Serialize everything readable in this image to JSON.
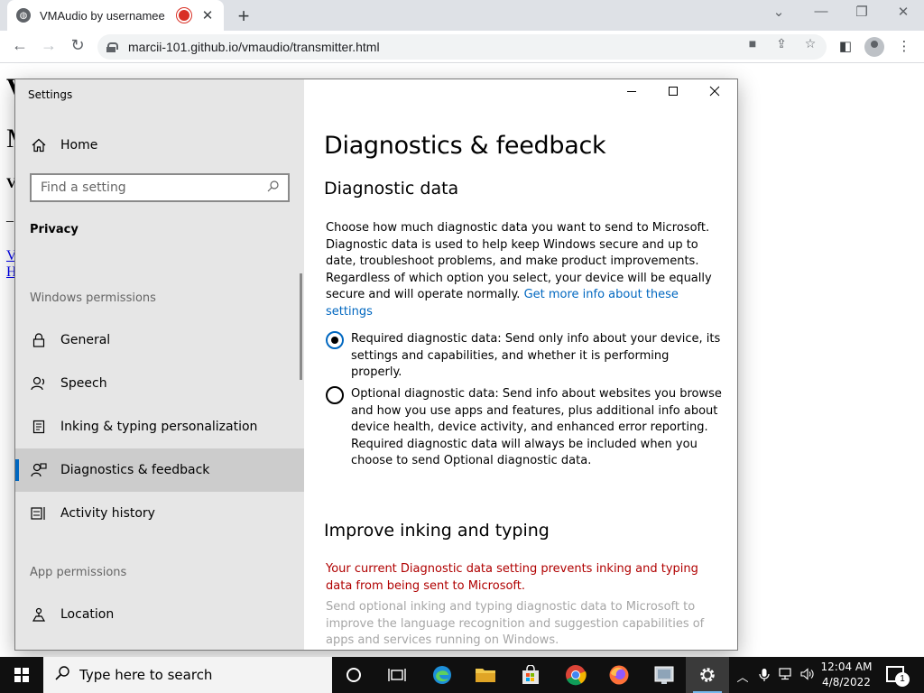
{
  "browser": {
    "tab_title": "VMAudio by usernamee",
    "tab_close": "✕",
    "new_tab": "+",
    "url": "marcii-101.github.io/vmaudio/transmitter.html",
    "win_minimize": "—",
    "win_restore": "❐",
    "win_close": "✕",
    "win_tabsearch": "⌄"
  },
  "bg_page": {
    "frag_1": "V",
    "frag_2": "M",
    "frag_3": "V",
    "frag_4": "_",
    "link_1": "V",
    "link_2": "H"
  },
  "settings": {
    "window_title": "Settings",
    "home_label": "Home",
    "search_placeholder": "Find a setting",
    "category": "Privacy",
    "windows_permissions_heading": "Windows permissions",
    "app_permissions_heading": "App permissions",
    "nav_items": [
      {
        "label": "General",
        "icon": "lock-icon"
      },
      {
        "label": "Speech",
        "icon": "speech-icon"
      },
      {
        "label": "Inking & typing personalization",
        "icon": "inking-icon"
      },
      {
        "label": "Diagnostics & feedback",
        "icon": "diagnostics-icon",
        "selected": true
      },
      {
        "label": "Activity history",
        "icon": "activity-icon"
      }
    ],
    "location_label": "Location",
    "page_title": "Diagnostics & feedback",
    "diag_heading": "Diagnostic data",
    "diag_description": "Choose how much diagnostic data you want to send to Microsoft. Diagnostic data is used to help keep Windows secure and up to date, troubleshoot problems, and make product improvements. Regardless of which option you select, your device will be equally secure and will operate normally.",
    "diag_link": "Get more info about these settings",
    "radio_required": "Required diagnostic data: Send only info about your device, its settings and capabilities, and whether it is performing properly.",
    "radio_optional": "Optional diagnostic data: Send info about websites you browse and how you use apps and features, plus additional info about device health, device activity, and enhanced error reporting. Required diagnostic data will always be included when you choose to send Optional diagnostic data.",
    "selected_option": "required",
    "inking_heading": "Improve inking and typing",
    "inking_warning": "Your current Diagnostic data setting prevents inking and typing data from being sent to Microsoft.",
    "inking_description": "Send optional inking and typing diagnostic data to Microsoft to improve the language recognition and suggestion capabilities of apps and services running on Windows.",
    "accent_color": "#0067c0",
    "warning_color": "#b00000"
  },
  "taskbar": {
    "search_placeholder": "Type here to search",
    "time": "12:04 AM",
    "date": "4/8/2022",
    "notification_count": "1"
  }
}
